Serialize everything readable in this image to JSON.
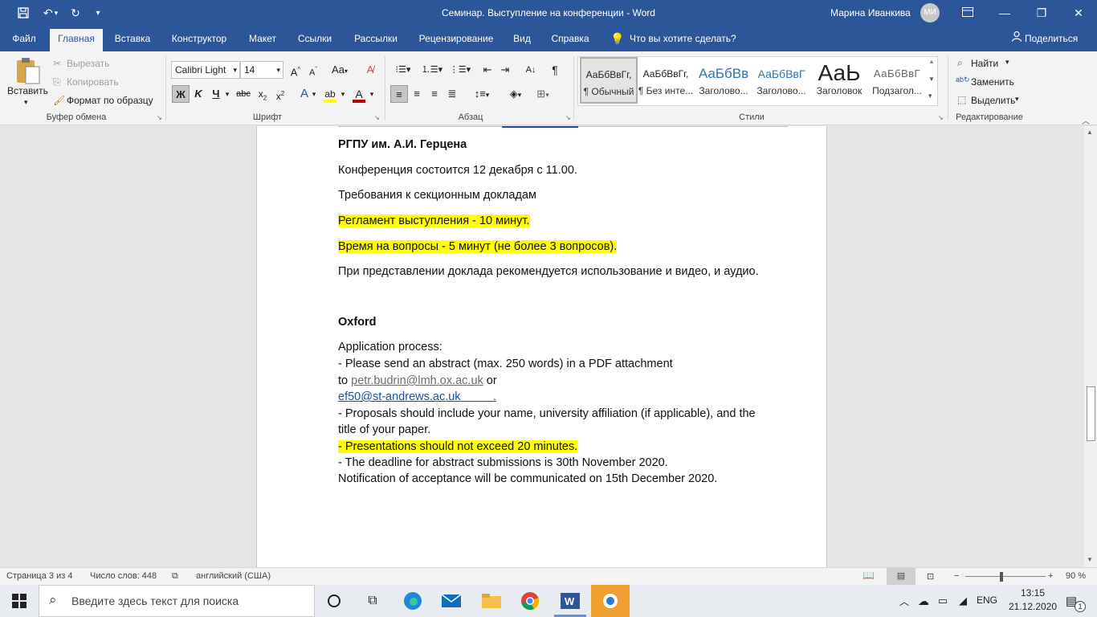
{
  "titlebar": {
    "title": "Семинар. Выступление на конференции  -  Word",
    "user": "Марина Иванкива",
    "avatar": "МИ"
  },
  "tabs": [
    "Файл",
    "Главная",
    "Вставка",
    "Конструктор",
    "Макет",
    "Ссылки",
    "Рассылки",
    "Рецензирование",
    "Вид",
    "Справка"
  ],
  "tellme": "Что вы хотите сделать?",
  "share": "Поделиться",
  "clipboard": {
    "paste": "Вставить",
    "cut": "Вырезать",
    "copy": "Копировать",
    "painter": "Формат по образцу",
    "label": "Буфер обмена"
  },
  "font": {
    "name": "Calibri Light",
    "size": "14",
    "label": "Шрифт"
  },
  "paragraph": {
    "label": "Абзац"
  },
  "styles": {
    "label": "Стили",
    "items": [
      {
        "preview": "АаБбВвГг,",
        "name": "¶ Обычный"
      },
      {
        "preview": "АаБбВвГг,",
        "name": "¶ Без инте..."
      },
      {
        "preview": "АаБбВв",
        "name": "Заголово..."
      },
      {
        "preview": "АаБбВвГ",
        "name": "Заголово..."
      },
      {
        "preview": "АаЬ",
        "name": "Заголовок"
      },
      {
        "preview": "АаБбВвГ",
        "name": "Подзагол..."
      }
    ]
  },
  "editing": {
    "find": "Найти",
    "replace": "Заменить",
    "select": "Выделить",
    "label": "Редактирование"
  },
  "doc": {
    "l1": "РГПУ им. А.И. Герцена",
    "l2": "Конференция состоится 12 декабря с 11.00.",
    "l3": "Требования к секционным докладам",
    "l4": "Регламент выступления - 10 минут.",
    "l5": "Время на вопросы - 5 минут (не более 3 вопросов).",
    "l6": "При представлении доклада рекомендуется использование и видео, и аудио.",
    "l7": "Oxford",
    "l8": "Application process:",
    "l9": "- Please send an abstract (max. 250 words) in a PDF attachment",
    "l10a": "to ",
    "l10b": "petr.budrin@lmh.ox.ac.uk",
    "l10c": " or",
    "l11a": "ef50@st-andrews.ac.uk",
    "l11b": "          .",
    "l12": "- Proposals should include your name, university affiliation (if applicable), and the",
    "l13": "title of your paper.",
    "l14": "- Presentations should not exceed 20 minutes.",
    "l15": "- The deadline for abstract submissions is 30th November 2020.",
    "l16": "Notification of acceptance will be communicated on 15th December 2020."
  },
  "status": {
    "page": "Страница 3 из 4",
    "words": "Число слов: 448",
    "lang": "английский (США)",
    "zoom": "90 %"
  },
  "taskbar": {
    "search": "Введите здесь текст для поиска",
    "lang": "ENG",
    "time": "13:15",
    "date": "21.12.2020",
    "notif": "1"
  },
  "colors": {
    "accent": "#2b579a",
    "highlight": "#ffff00",
    "fontColor": "#c00000"
  }
}
